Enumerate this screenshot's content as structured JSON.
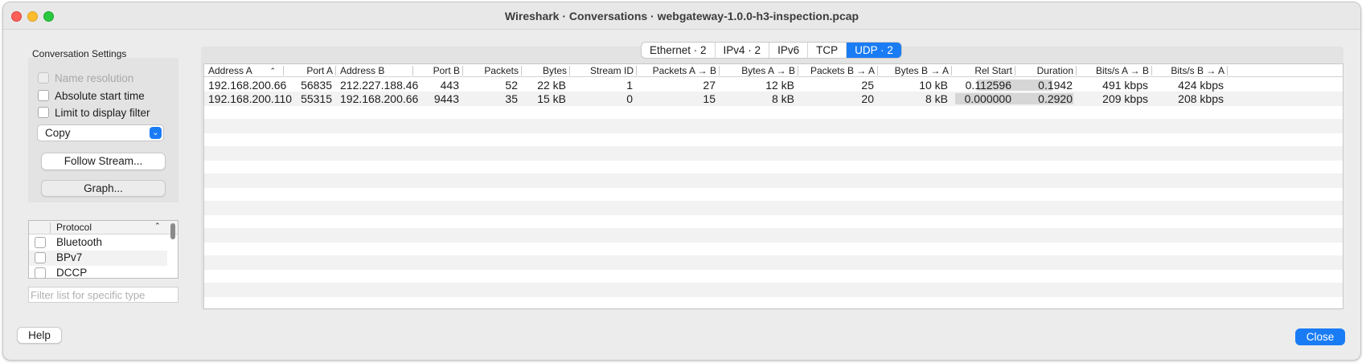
{
  "window": {
    "title": "Wireshark · Conversations · webgateway-1.0.0-h3-inspection.pcap"
  },
  "settings": {
    "title": "Conversation Settings",
    "name_resolution_label": "Name resolution",
    "absolute_start_time_label": "Absolute start time",
    "limit_to_display_filter_label": "Limit to display filter",
    "copy_select_value": "Copy",
    "follow_stream_label": "Follow Stream...",
    "graph_label": "Graph..."
  },
  "protocols": {
    "header": "Protocol",
    "items": [
      {
        "label": "Bluetooth"
      },
      {
        "label": "BPv7"
      },
      {
        "label": "DCCP"
      }
    ],
    "filter_placeholder": "Filter list for specific type"
  },
  "tabs": [
    {
      "label": "Ethernet · 2"
    },
    {
      "label": "IPv4 · 2"
    },
    {
      "label": "IPv6"
    },
    {
      "label": "TCP"
    },
    {
      "label": "UDP · 2"
    }
  ],
  "active_tab": "UDP · 2",
  "table": {
    "columns": [
      "Address A",
      "Port A",
      "Address B",
      "Port B",
      "Packets",
      "Bytes",
      "Stream ID",
      "Packets A → B",
      "Bytes A → B",
      "Packets B → A",
      "Bytes B → A",
      "Rel Start",
      "Duration",
      "Bits/s A → B",
      "Bits/s B → A"
    ],
    "rows": [
      {
        "cells": [
          "192.168.200.66",
          "56835",
          "212.227.188.46",
          "443",
          "52",
          "22 kB",
          "1",
          "27",
          "12 kB",
          "25",
          "10 kB",
          "0.112596",
          "0.1942",
          "491 kbps",
          "424 kbps"
        ],
        "rel_start_fraction": 0.386,
        "duration_fraction": 0.665
      },
      {
        "cells": [
          "192.168.200.110",
          "55315",
          "192.168.200.66",
          "9443",
          "35",
          "15 kB",
          "0",
          "15",
          "8 kB",
          "20",
          "8 kB",
          "0.000000",
          "0.2920",
          "209 kbps",
          "208 kbps"
        ],
        "rel_start_fraction": 0.0,
        "duration_fraction": 1.0
      }
    ]
  },
  "buttons": {
    "help": "Help",
    "close": "Close"
  },
  "colors": {
    "accent": "#1a7cf5",
    "close_red": "#fe5f57",
    "minimize_yellow": "#febc2e",
    "maximize_green": "#28c840"
  }
}
